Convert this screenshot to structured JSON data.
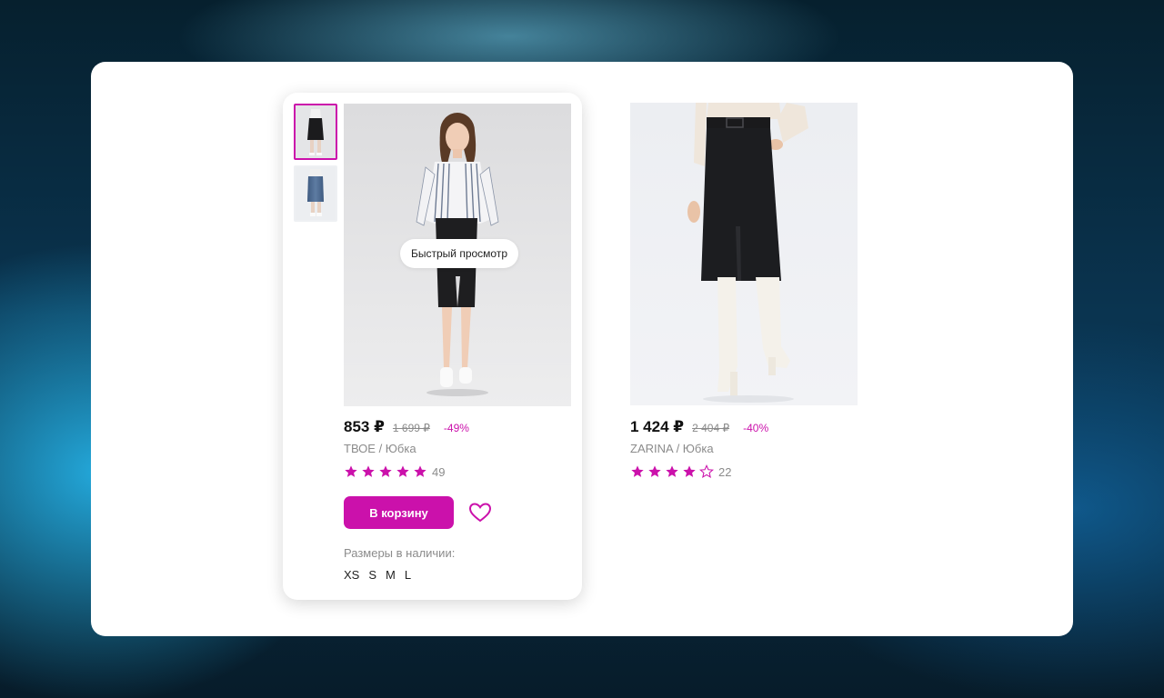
{
  "colors": {
    "accent": "#cb11ab",
    "star": "#cb11ab",
    "text_muted": "#8b8b8b"
  },
  "products": [
    {
      "price": "853 ₽",
      "old_price": "1 699 ₽",
      "discount": "-49%",
      "brand": "ТВОЕ / Юбка",
      "rating": 5,
      "reviews": "49",
      "quick_view": "Быстрый просмотр",
      "cart_button": "В корзину",
      "sizes_label": "Размеры в наличии:",
      "sizes": [
        "XS",
        "S",
        "M",
        "L"
      ],
      "favorite_icon": "heart-icon"
    },
    {
      "price": "1 424 ₽",
      "old_price": "2 404 ₽",
      "discount": "-40%",
      "brand": "ZARINA / Юбка",
      "rating": 4,
      "reviews": "22"
    }
  ]
}
